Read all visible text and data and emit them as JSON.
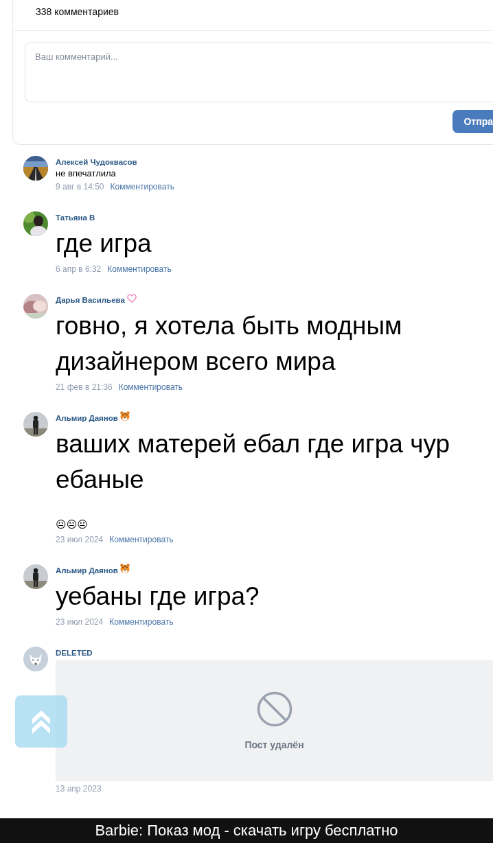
{
  "comments_header": {
    "count": "338 комментариев"
  },
  "comment_form": {
    "placeholder": "Ваш комментарий...",
    "submit": "Отпра"
  },
  "comments": [
    {
      "kind": "text",
      "author": "Алексей Чудоквасов",
      "lines": [
        "не впечатлила"
      ],
      "date": "9 авг в 14:50",
      "action": "Комментировать"
    },
    {
      "kind": "large_text",
      "author": "Татьяна В",
      "lines": [
        "где игра"
      ],
      "date": "6 апр в 6:32",
      "action": "Комментировать"
    },
    {
      "kind": "large_text",
      "author": "Дарья Васильева",
      "lines": [
        "говно, я хотела быть модным",
        "дизайнером всего мира"
      ],
      "date": "21 фев в 21:36",
      "action": "Комментировать"
    },
    {
      "kind": "large_text",
      "author": "Альмир Даянов",
      "lines": [
        "ваших матерей ебал где игра чур",
        "ебаные"
      ],
      "emoji": "😐😐😐",
      "date": "23 июл 2024",
      "action": "Комментировать"
    },
    {
      "kind": "large_text",
      "author": "Альмир Даянов",
      "lines": [
        "уебаны где игра?"
      ],
      "date": "23 июл 2024",
      "action": "Комментировать"
    },
    {
      "kind": "deleted_post",
      "author": "DELETED",
      "notice": "Пост удалён",
      "date": "13 апр 2023"
    }
  ],
  "caption": "Barbie: Показ мод - скачать игру бесплатно"
}
